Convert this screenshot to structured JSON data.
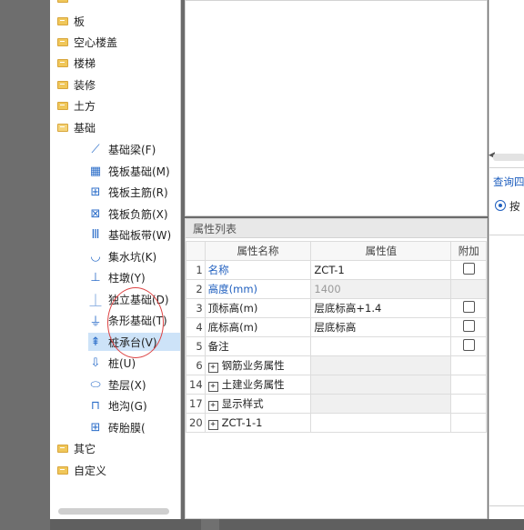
{
  "tree": {
    "categories": [
      {
        "label": "板"
      },
      {
        "label": "空心楼盖"
      },
      {
        "label": "楼梯"
      },
      {
        "label": "装修"
      },
      {
        "label": "土方"
      },
      {
        "label": "基础"
      }
    ],
    "foundation_items": [
      {
        "label": "基础梁(F)",
        "icon": "beam-icon"
      },
      {
        "label": "筏板基础(M)",
        "icon": "raft-icon"
      },
      {
        "label": "筏板主筋(R)",
        "icon": "rebar-icon"
      },
      {
        "label": "筏板负筋(X)",
        "icon": "neg-rebar-icon"
      },
      {
        "label": "基础板带(W)",
        "icon": "strip-icon"
      },
      {
        "label": "集水坑(K)",
        "icon": "sump-icon"
      },
      {
        "label": "柱墩(Y)",
        "icon": "pier-icon"
      },
      {
        "label": "独立基础(D)",
        "icon": "isolated-foundation-icon"
      },
      {
        "label": "条形基础(T)",
        "icon": "strip-foundation-icon"
      },
      {
        "label": "桩承台(V)",
        "icon": "pile-cap-icon"
      },
      {
        "label": "桩(U)",
        "icon": "pile-icon"
      },
      {
        "label": "垫层(X)",
        "icon": "cushion-icon"
      },
      {
        "label": "地沟(G)",
        "icon": "trench-icon"
      },
      {
        "label": "砖胎膜(",
        "icon": "brick-mold-icon"
      }
    ],
    "other_categories": [
      {
        "label": "其它"
      },
      {
        "label": "自定义"
      }
    ],
    "selected": "桩承台(V)"
  },
  "properties": {
    "panel_title": "属性列表",
    "columns": [
      "属性名称",
      "属性值",
      "附加"
    ],
    "rows": [
      {
        "num": "1",
        "name": "名称",
        "value": "ZCT-1"
      },
      {
        "num": "2",
        "name": "高度(mm)",
        "value": "1400"
      },
      {
        "num": "3",
        "name": "顶标高(m)",
        "value": "层底标高+1.4"
      },
      {
        "num": "4",
        "name": "底标高(m)",
        "value": "层底标高"
      },
      {
        "num": "5",
        "name": "备注",
        "value": ""
      },
      {
        "num": "6",
        "name": "钢筋业务属性",
        "value": ""
      },
      {
        "num": "14",
        "name": "土建业务属性",
        "value": ""
      },
      {
        "num": "17",
        "name": "显示样式",
        "value": ""
      },
      {
        "num": "20",
        "name": "ZCT-1-1",
        "value": ""
      }
    ]
  },
  "right_panel": {
    "title": "查询四",
    "radio_label": "按"
  },
  "colors": {
    "accent_blue": "#1f5fbf",
    "selection": "#cde3f8",
    "annotation_red": "#d44444",
    "folder_yellow": "#f0c75a"
  }
}
